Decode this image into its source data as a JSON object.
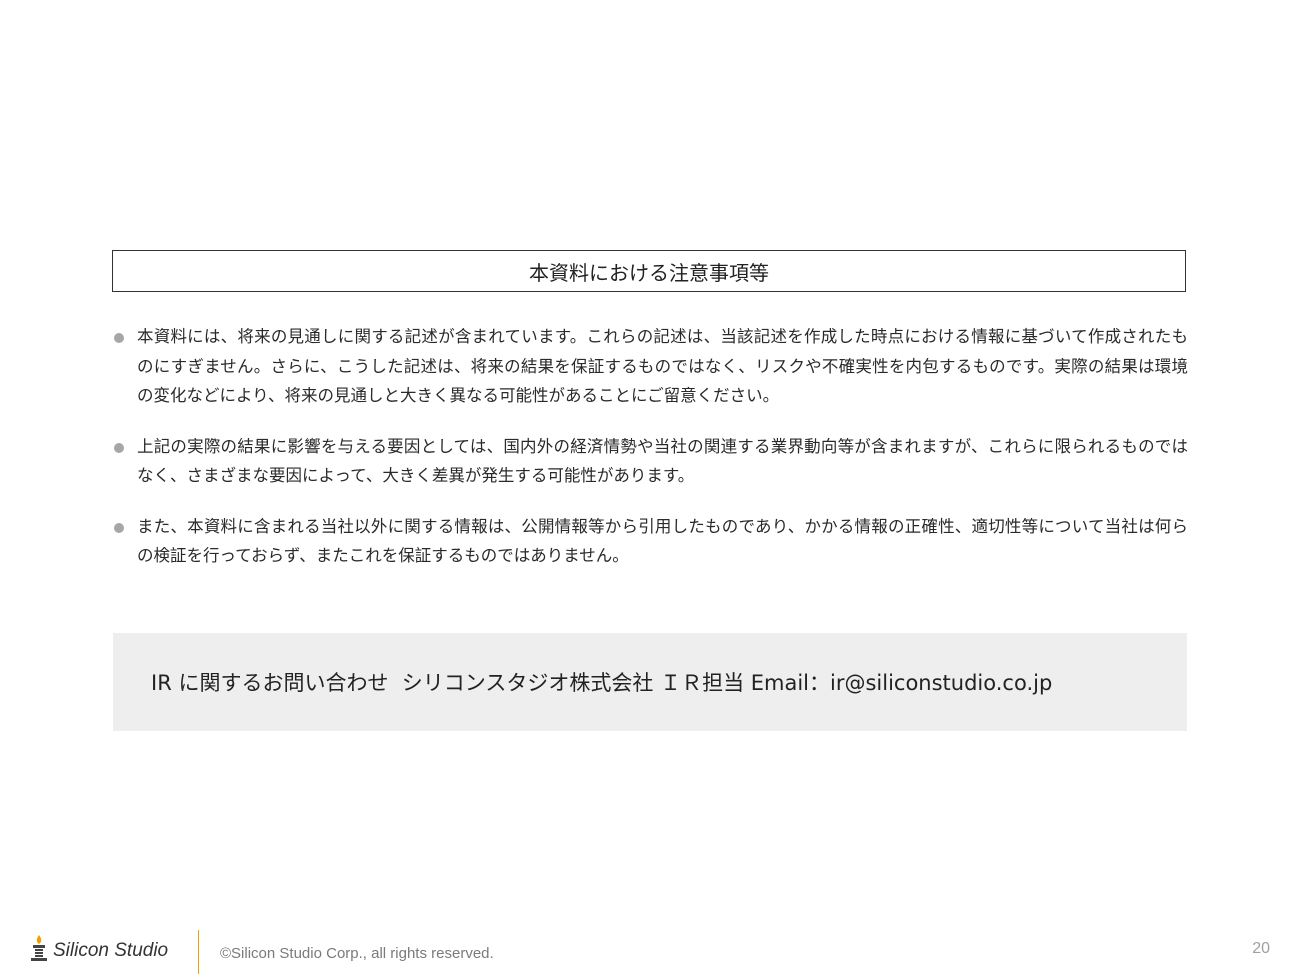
{
  "notice": {
    "title": "本資料における注意事項等",
    "bullets": [
      "本資料には、将来の見通しに関する記述が含まれています。これらの記述は、当該記述を作成した時点における情報に基づいて作成されたものにすぎません。さらに、こうした記述は、将来の結果を保証するものではなく、リスクや不確実性を内包するものです。実際の結果は環境の変化などにより、将来の見通しと大きく異なる可能性があることにご留意ください。",
      "上記の実際の結果に影響を与える要因としては、国内外の経済情勢や当社の関連する業界動向等が含まれますが、これらに限られるものではなく、さまざまな要因によって、大きく差異が発生する可能性があります。",
      "また、本資料に含まれる当社以外に関する情報は、公開情報等から引用したものであり、かかる情報の正確性、適切性等について当社は何らの検証を行っておらず、またこれを保証するものではありません。"
    ]
  },
  "contact": {
    "text": "IR に関するお問い合わせ  シリコンスタジオ株式会社 ＩＲ担当 Email：ir@siliconstudio.co.jp"
  },
  "footer": {
    "logo_text": "Silicon Studio",
    "logo_icon": "candle-logo-icon",
    "copyright": "©Silicon Studio Corp., all rights reserved.",
    "page_number": "20",
    "accent_color": "#f0a000"
  }
}
